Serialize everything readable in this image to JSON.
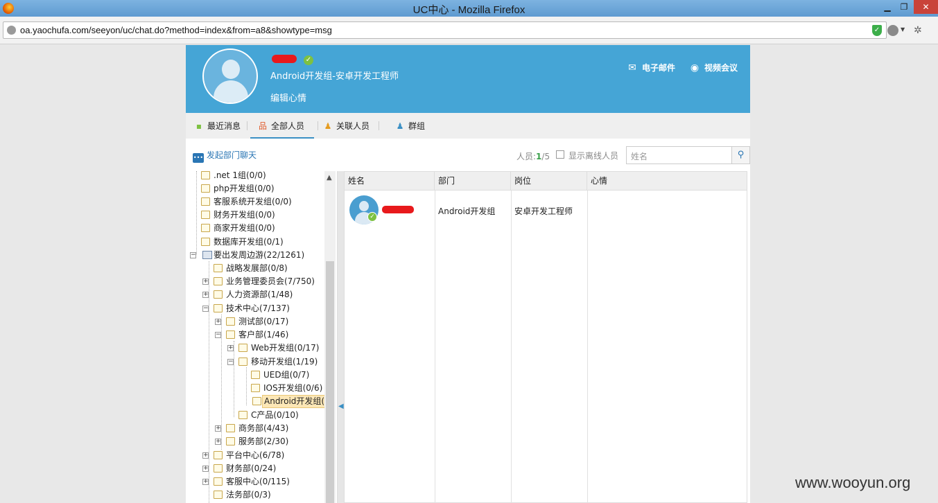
{
  "window": {
    "title": "UC中心 - Mozilla Firefox",
    "min_glyph": "▁",
    "max_glyph": "❐",
    "close_glyph": "✕"
  },
  "browser": {
    "url": "oa.yaochufa.com/seeyon/uc/chat.do?method=index&from=a8&showtype=msg"
  },
  "profile": {
    "dept_position": "Android开发组-安卓开发工程师",
    "edit_mood": "编辑心情",
    "email_label": "电子邮件",
    "video_label": "视频会议"
  },
  "tabs": [
    {
      "label": "最近消息"
    },
    {
      "label": "全部人员"
    },
    {
      "label": "关联人员"
    },
    {
      "label": "群组"
    }
  ],
  "toolbar": {
    "dept_chat": "发起部门聊天",
    "count_prefix": "人员:",
    "count_online": "1",
    "count_total": "/5",
    "show_offline": "显示离线人员",
    "search_placeholder": "姓名"
  },
  "tree": [
    {
      "label": ".net 1组(0/0)"
    },
    {
      "label": "php开发组(0/0)"
    },
    {
      "label": "客服系统开发组(0/0)"
    },
    {
      "label": "财务开发组(0/0)"
    },
    {
      "label": "商家开发组(0/0)"
    },
    {
      "label": "数据库开发组(0/1)"
    },
    {
      "label": "要出发周边游(22/1261)"
    },
    {
      "label": "战略发展部(0/8)"
    },
    {
      "label": "业务管理委员会(7/750)"
    },
    {
      "label": "人力资源部(1/48)"
    },
    {
      "label": "技术中心(7/137)"
    },
    {
      "label": "测试部(0/17)"
    },
    {
      "label": "客户部(1/46)"
    },
    {
      "label": "Web开发组(0/17)"
    },
    {
      "label": "移动开发组(1/19)"
    },
    {
      "label": "UED组(0/7)"
    },
    {
      "label": "IOS开发组(0/6)"
    },
    {
      "label": "Android开发组("
    },
    {
      "label": "C产品(0/10)"
    },
    {
      "label": "商务部(4/43)"
    },
    {
      "label": "服务部(2/30)"
    },
    {
      "label": "平台中心(6/78)"
    },
    {
      "label": "财务部(0/24)"
    },
    {
      "label": "客服中心(0/115)"
    },
    {
      "label": "法务部(0/3)"
    }
  ],
  "table": {
    "headers": [
      "姓名",
      "部门",
      "岗位",
      "心情"
    ],
    "rows": [
      {
        "dept": "Android开发组",
        "post": "安卓开发工程师",
        "mood": ""
      }
    ]
  },
  "watermark": "www.wooyun.org",
  "colors": {
    "header_blue": "#45a5d6",
    "online_green": "#3aa04a",
    "redaction_red": "#e8191c"
  }
}
